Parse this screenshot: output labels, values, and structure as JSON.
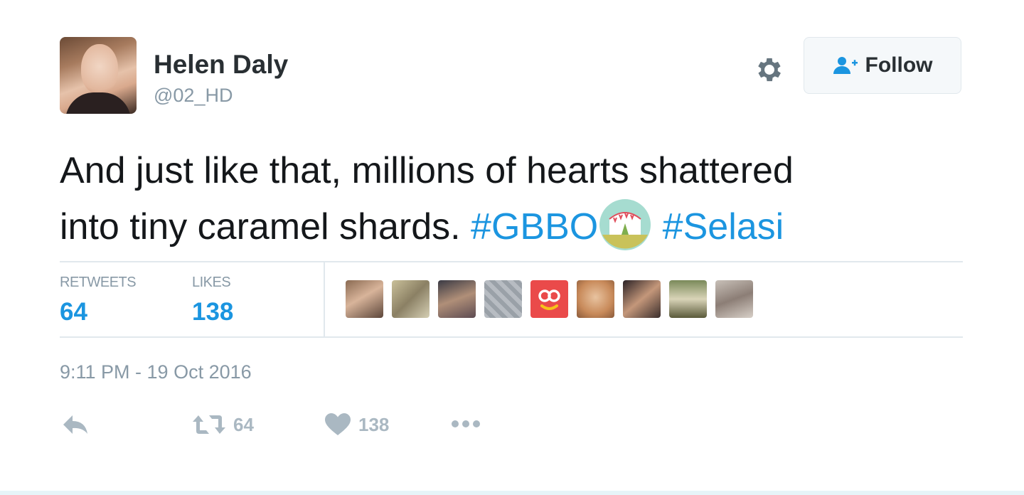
{
  "user": {
    "name": "Helen Daly",
    "handle": "@02_HD"
  },
  "follow_label": "Follow",
  "tweet": {
    "line1": "And just like that, millions of hearts shattered",
    "line2": "into tiny caramel shards. ",
    "hashtag1": "#GBBO",
    "hashtag2": "#Selasi"
  },
  "stats": {
    "retweets_label": "RETWEETS",
    "retweets": "64",
    "likes_label": "LIKES",
    "likes": "138"
  },
  "timestamp": "9:11 PM - 19 Oct 2016",
  "actions": {
    "retweet_count": "64",
    "like_count": "138"
  },
  "colors": {
    "link": "#1b95e0",
    "muted": "#8899a6",
    "action": "#aab8c2"
  },
  "icons": [
    "gear-icon",
    "follow-person-icon",
    "tent-emoji-icon",
    "reply-icon",
    "retweet-icon",
    "heart-icon",
    "more-icon"
  ]
}
